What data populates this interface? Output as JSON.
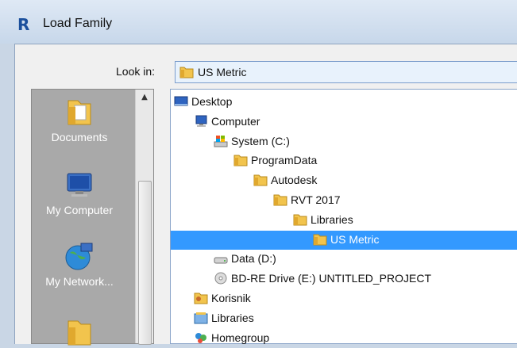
{
  "window": {
    "logo": "R",
    "title": "Load Family"
  },
  "look_in": {
    "label": "Look in:",
    "value": "US Metric",
    "icon": "folder-icon"
  },
  "places": [
    {
      "label": "Documents",
      "icon": "documents-folder-icon"
    },
    {
      "label": "My Computer",
      "icon": "computer-monitor-icon"
    },
    {
      "label": "My Network...",
      "icon": "network-globe-icon"
    },
    {
      "label": "",
      "icon": "folder-icon"
    }
  ],
  "tree": [
    {
      "label": "Desktop",
      "icon": "desktop-icon",
      "indent": 0,
      "selected": false
    },
    {
      "label": "Computer",
      "icon": "computer-icon",
      "indent": 1,
      "selected": false
    },
    {
      "label": "System (C:)",
      "icon": "windows-drive-icon",
      "indent": 2,
      "selected": false
    },
    {
      "label": "ProgramData",
      "icon": "folder-icon",
      "indent": 3,
      "selected": false
    },
    {
      "label": "Autodesk",
      "icon": "folder-icon",
      "indent": 4,
      "selected": false
    },
    {
      "label": "RVT 2017",
      "icon": "folder-icon",
      "indent": 5,
      "selected": false
    },
    {
      "label": "Libraries",
      "icon": "folder-icon",
      "indent": 6,
      "selected": false
    },
    {
      "label": "US Metric",
      "icon": "folder-icon",
      "indent": 7,
      "selected": true
    },
    {
      "label": "Data (D:)",
      "icon": "hard-drive-icon",
      "indent": 2,
      "selected": false
    },
    {
      "label": "BD-RE Drive (E:) UNTITLED_PROJECT",
      "icon": "optical-drive-icon",
      "indent": 2,
      "selected": false
    },
    {
      "label": "Korisnik",
      "icon": "user-folder-icon",
      "indent": 1,
      "selected": false
    },
    {
      "label": "Libraries",
      "icon": "libraries-icon",
      "indent": 1,
      "selected": false
    },
    {
      "label": "Homegroup",
      "icon": "homegroup-icon",
      "indent": 1,
      "selected": false
    }
  ],
  "colors": {
    "selection": "#3399ff",
    "places_bg": "#a9a9a9",
    "folder": "#f2c44d"
  }
}
